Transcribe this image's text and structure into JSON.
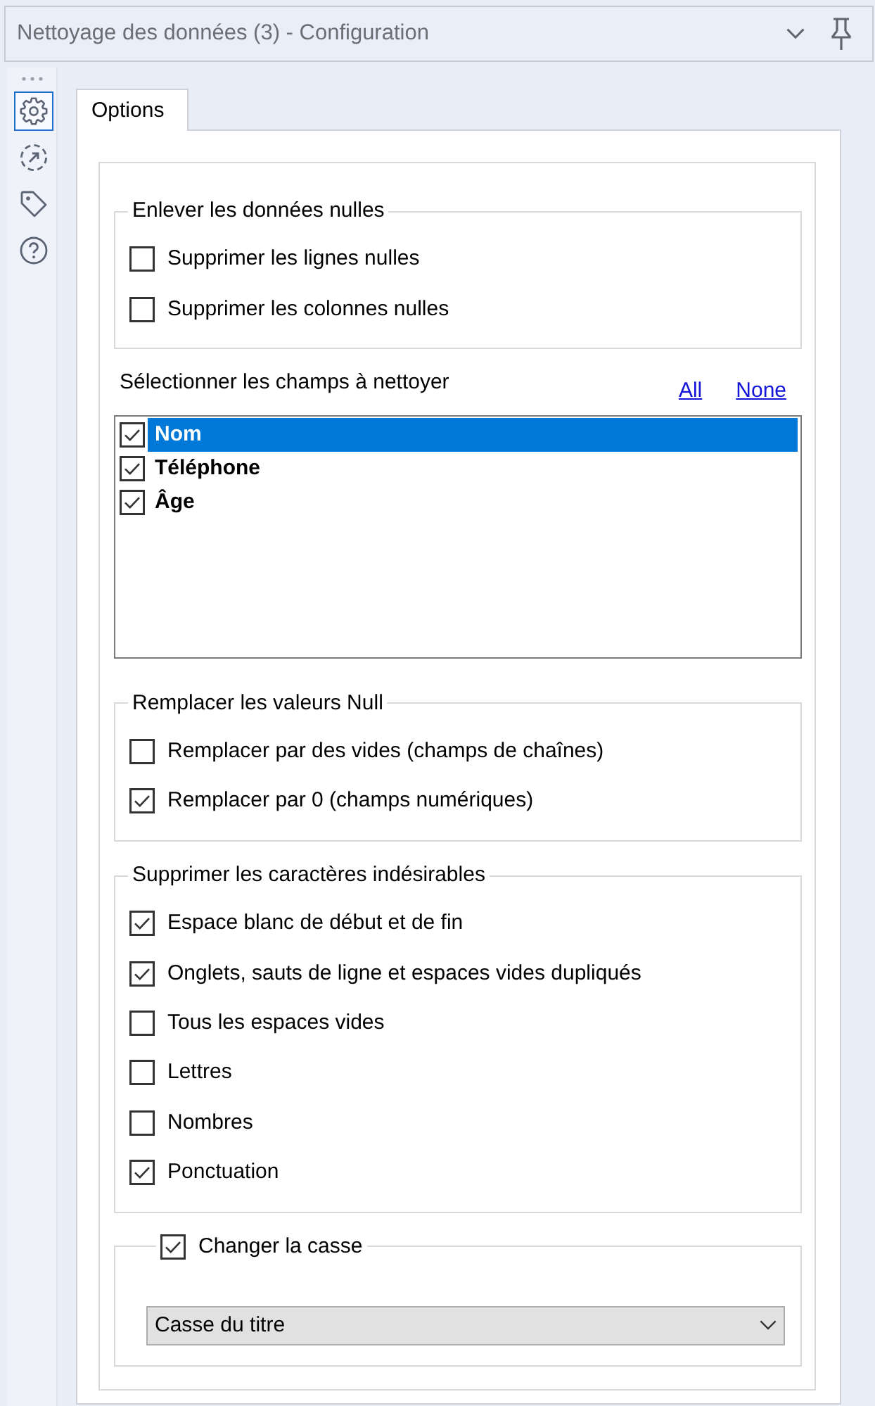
{
  "window": {
    "title": "Nettoyage des données (3) - Configuration"
  },
  "sidebar": {
    "items": [
      {
        "kind": "gear",
        "selected": true
      },
      {
        "kind": "dashed_arrow",
        "selected": false
      },
      {
        "kind": "tag",
        "selected": false
      },
      {
        "kind": "help",
        "selected": false
      }
    ]
  },
  "tabs": [
    {
      "label": "Options",
      "selected": true
    }
  ],
  "sections": [
    {
      "kind": "group",
      "title": "Enlever les données nulles",
      "options": [
        {
          "label": "Supprimer les lignes nulles",
          "checked": false
        },
        {
          "label": "Supprimer les colonnes nulles",
          "checked": false
        }
      ]
    },
    {
      "kind": "field_list",
      "label": "Sélectionner les champs à nettoyer",
      "links": [
        "All",
        "None"
      ],
      "fields": [
        {
          "name": "Nom",
          "checked": true,
          "selected": true
        },
        {
          "name": "Téléphone",
          "checked": true,
          "selected": false
        },
        {
          "name": "Âge",
          "checked": true,
          "selected": false
        }
      ]
    },
    {
      "kind": "group",
      "title": "Remplacer les valeurs Null",
      "options": [
        {
          "label": "Remplacer par des vides (champs de chaînes)",
          "checked": false
        },
        {
          "label": "Remplacer par 0 (champs numériques)",
          "checked": true
        }
      ]
    },
    {
      "kind": "group",
      "title": "Supprimer les caractères indésirables",
      "options": [
        {
          "label": "Espace blanc de début et de fin",
          "checked": true
        },
        {
          "label": "Onglets, sauts de ligne et espaces vides dupliqués",
          "checked": true
        },
        {
          "label": "Tous les espaces vides",
          "checked": false
        },
        {
          "label": "Lettres",
          "checked": false
        },
        {
          "label": "Nombres",
          "checked": false
        },
        {
          "label": "Ponctuation",
          "checked": true
        }
      ]
    },
    {
      "kind": "checked_group",
      "title": "Changer la casse",
      "checked": true,
      "dropdown": {
        "value": "Casse du titre"
      }
    }
  ]
}
